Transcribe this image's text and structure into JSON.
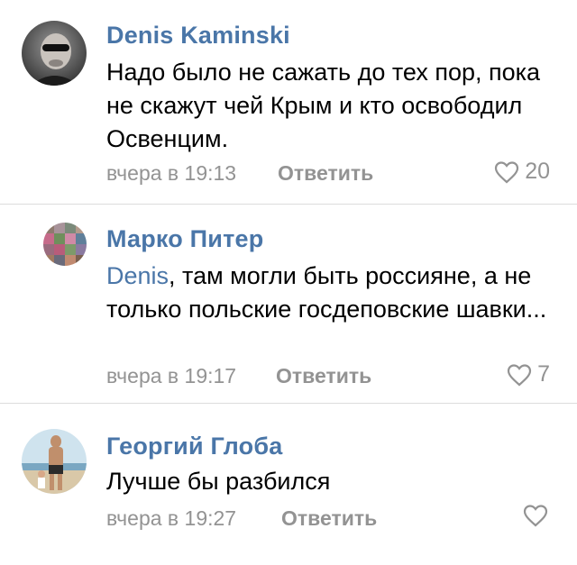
{
  "comments": [
    {
      "author": "Denis Kaminski",
      "mention": "",
      "text": "Надо было не сажать до тех пор, пока не скажут чей Крым и кто освободил Освенцим.",
      "time": "вчера в 19:13",
      "reply_label": "Ответить",
      "likes": "20"
    },
    {
      "author": "Марко Питер",
      "mention": "Denis",
      "text": ", там могли быть россияне, а не только польские госдеповские шавки...",
      "time": "вчера в 19:17",
      "reply_label": "Ответить",
      "likes": "7"
    },
    {
      "author": "Георгий Глоба",
      "mention": "",
      "text": "Лучше бы разбился",
      "time": "вчера в 19:27",
      "reply_label": "Ответить",
      "likes": ""
    }
  ],
  "colors": {
    "link": "#4a76a8",
    "muted": "#939393",
    "divider": "#dcdcdc"
  },
  "icons": {
    "like": "heart-outline-icon"
  }
}
